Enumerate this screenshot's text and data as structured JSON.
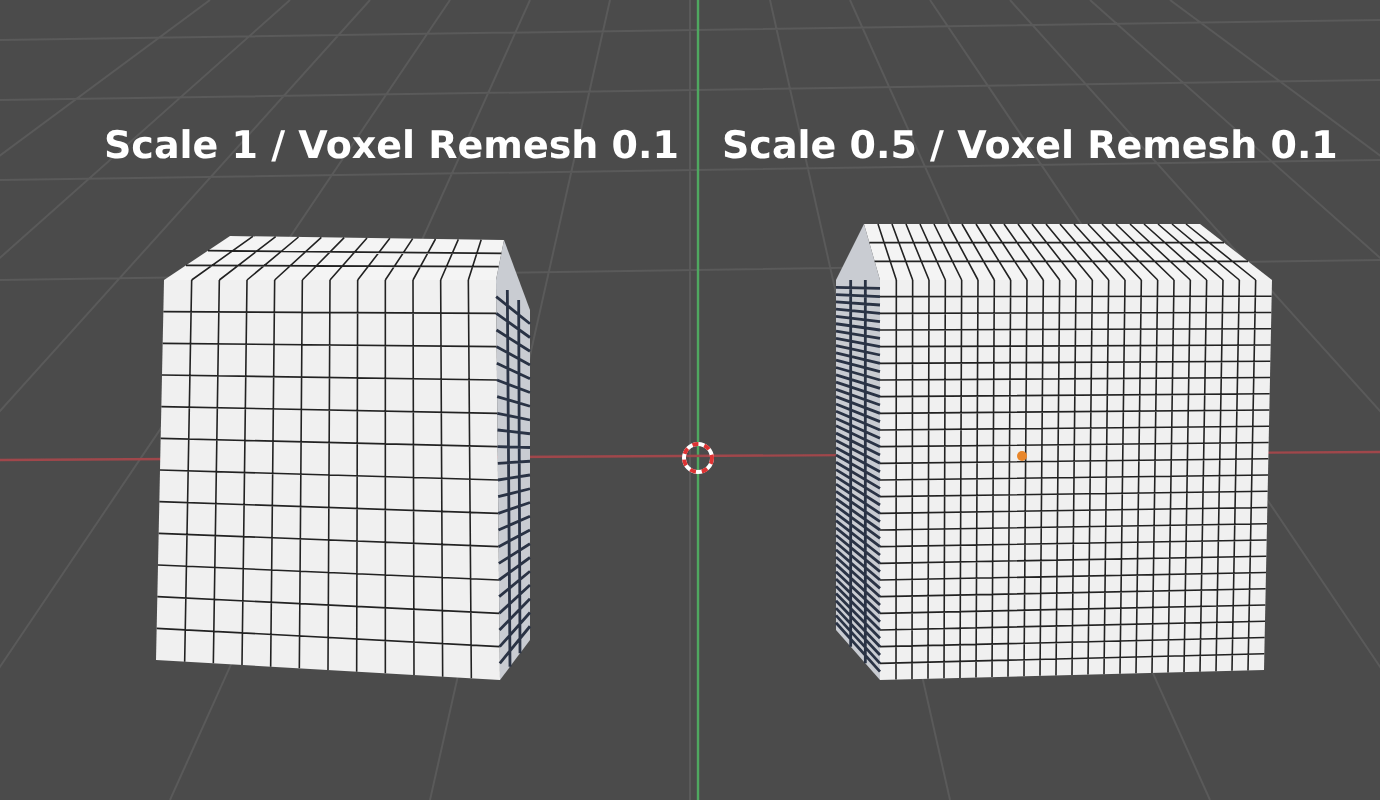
{
  "viewport": {
    "objects": [
      {
        "label": "Scale 1 / Voxel Remesh 0.1"
      },
      {
        "label": "Scale 0.5 / Voxel Remesh 0.1"
      }
    ]
  }
}
